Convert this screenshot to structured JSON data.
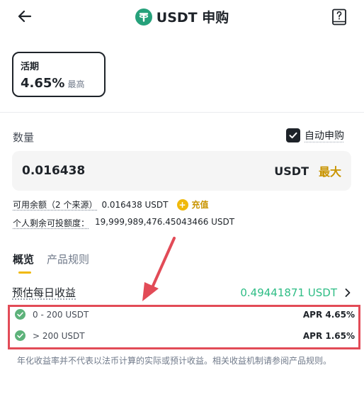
{
  "header": {
    "title": "USDT 申购",
    "back_icon": "arrow-left-icon",
    "coin_icon": "usdt-coin-icon",
    "guide_icon": "book-question-icon"
  },
  "term": {
    "label": "活期",
    "rate": "4.65%",
    "rate_note": "最高"
  },
  "amount": {
    "label": "数量",
    "auto_subscribe_label": "自动申购",
    "auto_subscribe_checked": true,
    "value": "0.016438",
    "unit": "USDT",
    "max_label": "最大"
  },
  "balance": {
    "available_label": "可用余额（2 个来源）",
    "available_value": "0.016438 USDT",
    "topup_label": "充值",
    "quota_label": "个人剩余可投额度：",
    "quota_value": "19,999,989,476.45043466 USDT"
  },
  "tabs": [
    {
      "label": "概览",
      "active": true
    },
    {
      "label": "产品规则",
      "active": false
    }
  ],
  "daily": {
    "label": "预估每日收益",
    "value": "0.49441871 USDT"
  },
  "tiers": [
    {
      "range": "0 - 200 USDT",
      "apr": "APR 4.65%"
    },
    {
      "range": "> 200 USDT",
      "apr": "APR 1.65%"
    }
  ],
  "disclaimer": "年化收益率并不代表以法币计算的实际或预计收益。相关收益机制请参阅产品规则。",
  "colors": {
    "accent": "#f0b90b",
    "accent_text": "#c99400",
    "positive": "#2ebd85",
    "check_green": "#5db27a",
    "highlight_red": "#e24b57"
  }
}
